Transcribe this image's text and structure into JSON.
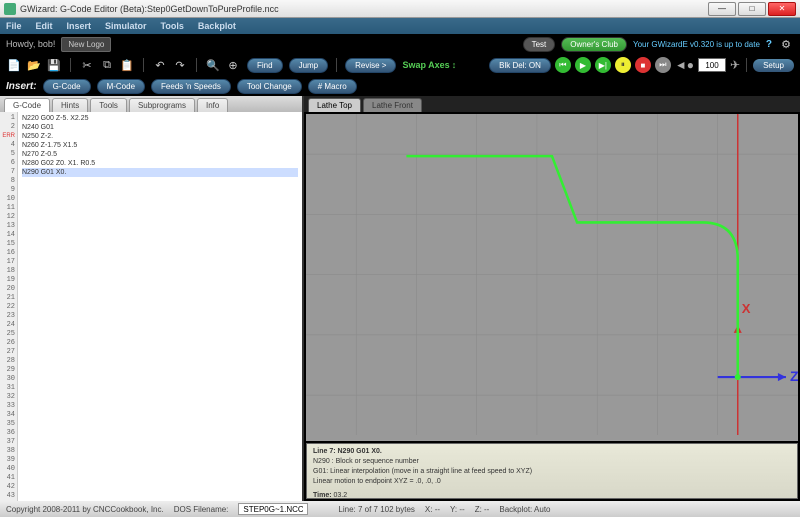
{
  "window": {
    "title": "GWizard: G-Code Editor (Beta):Step0GetDownToPureProfile.ncc"
  },
  "menu": [
    "File",
    "Edit",
    "Insert",
    "Simulator",
    "Tools",
    "Backplot"
  ],
  "infobar": {
    "howdy": "Howdy, bob!",
    "newlogo": "New Logo",
    "test": "Test",
    "ownersclub": "Owner's Club",
    "version": "Your GWizardE v0.320 is up to date",
    "help": "?"
  },
  "toolbar": {
    "find": "Find",
    "jump": "Jump",
    "revise": "Revise >",
    "swap": "Swap Axes",
    "blkdel": "Blk Del: ON",
    "speed": "100",
    "setup": "Setup"
  },
  "insert": {
    "label": "Insert:",
    "gcode": "G-Code",
    "mcode": "M-Code",
    "feeds": "Feeds 'n Speeds",
    "toolchange": "Tool Change",
    "macro": "# Macro"
  },
  "left_tabs": [
    "G-Code",
    "Hints",
    "Tools",
    "Subprograms",
    "Info"
  ],
  "code": [
    "N220 G00 Z-5. X2.25",
    "N240 G01",
    "N250 Z-2.",
    "N260 Z-1.75 X1.5",
    "N270 Z-0.5",
    "N280 G02 Z0. X1. R0.5",
    "N290 G01 X0."
  ],
  "view_tabs": [
    "Lathe Top",
    "Lathe Front"
  ],
  "axis": {
    "x": "X",
    "z": "Z"
  },
  "info_panel": {
    "line1": "Line 7: N290 G01 X0.",
    "line2": "N290 : Block or sequence number",
    "line3": "G01: Linear interpolation (move in a straight line at feed speed to XYZ)",
    "line4": "  Linear motion to endpoint XYZ = .0, .0, .0",
    "time_label": "Time:",
    "time_val": "03.2"
  },
  "status": {
    "copyright": "Copyright 2008-2011 by CNCCookbook, Inc.",
    "dosfile_label": "DOS Filename:",
    "dosfile": "STEP0G~1.NCC",
    "line": "Line:    7 of 7   102 bytes",
    "x": "X: --",
    "y": "Y: --",
    "z": "Z: --",
    "backplot": "Backplot: Auto"
  }
}
